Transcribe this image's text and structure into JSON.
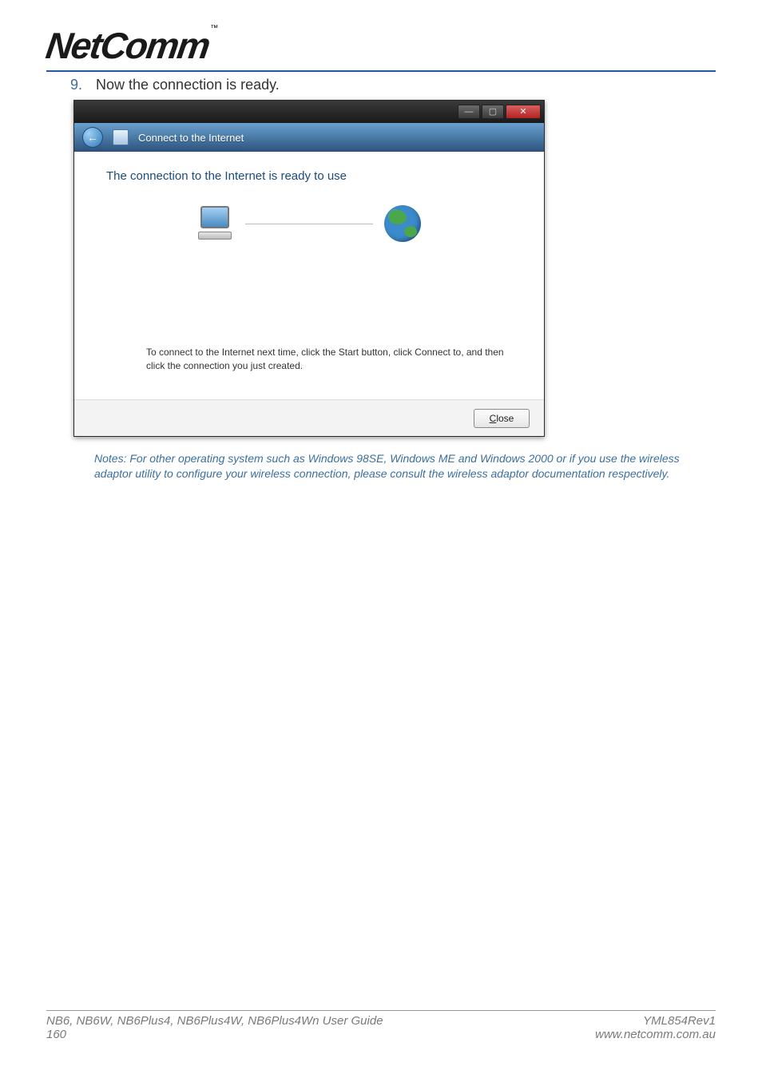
{
  "brand": {
    "name": "NetComm",
    "tm": "™"
  },
  "step": {
    "number": "9.",
    "text": "Now the connection is ready."
  },
  "dialog": {
    "nav_title": "Connect to the Internet",
    "heading": "The connection to the Internet is ready to use",
    "instruction": "To connect to the Internet next time, click the Start button, click Connect to, and then click the connection you just created.",
    "close_label": "lose",
    "close_prefix": "C"
  },
  "notes": "Notes: For other operating system such as Windows 98SE, Windows ME and Windows 2000 or if you use the wireless adaptor utility to configure your wireless connection, please consult the wireless adaptor documentation respectively.",
  "footer": {
    "guide": "NB6, NB6W, NB6Plus4, NB6Plus4W, NB6Plus4Wn User Guide",
    "page": "160",
    "rev": "YML854Rev1",
    "url": "www.netcomm.com.au"
  }
}
